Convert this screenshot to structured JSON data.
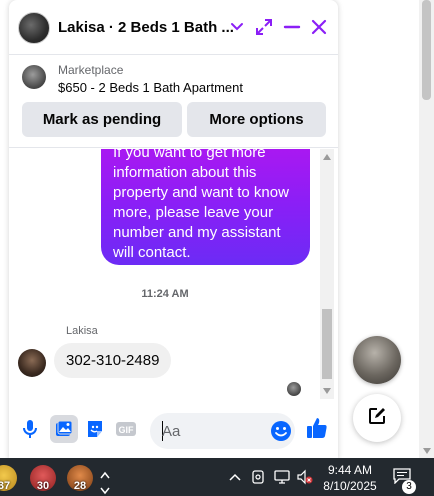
{
  "header": {
    "title": "Lakisa · 2 Beds 1 Bath ...",
    "accent_color": "#8b1ff6",
    "icons": [
      "chevron-down-icon",
      "expand-icon",
      "minimize-icon",
      "close-icon"
    ]
  },
  "product": {
    "label": "Marketplace",
    "listing": "$650 - 2 Beds 1 Bath Apartment",
    "buttons": [
      "Mark as pending",
      "More options"
    ]
  },
  "messages": {
    "outgoing_text": "If you want to get more information about this property and want to know more, please leave your number and my assistant will contact.",
    "timestamp": "11:24 AM",
    "sender": "Lakisa",
    "incoming_text": "302-310-2489"
  },
  "composer": {
    "placeholder": "Aa",
    "icons": [
      "microphone-icon",
      "photo-icon",
      "sticker-icon",
      "gif-icon",
      "emoji-icon",
      "thumbs-up-icon"
    ]
  },
  "taskbar": {
    "apps": [
      {
        "label": "37",
        "color": "#c9a227"
      },
      {
        "label": "30",
        "color": "#c43b3b"
      },
      {
        "label": "28",
        "color": "#c46b2b"
      }
    ],
    "time": "9:44 AM",
    "date": "8/10/2025",
    "notifications": "3"
  }
}
